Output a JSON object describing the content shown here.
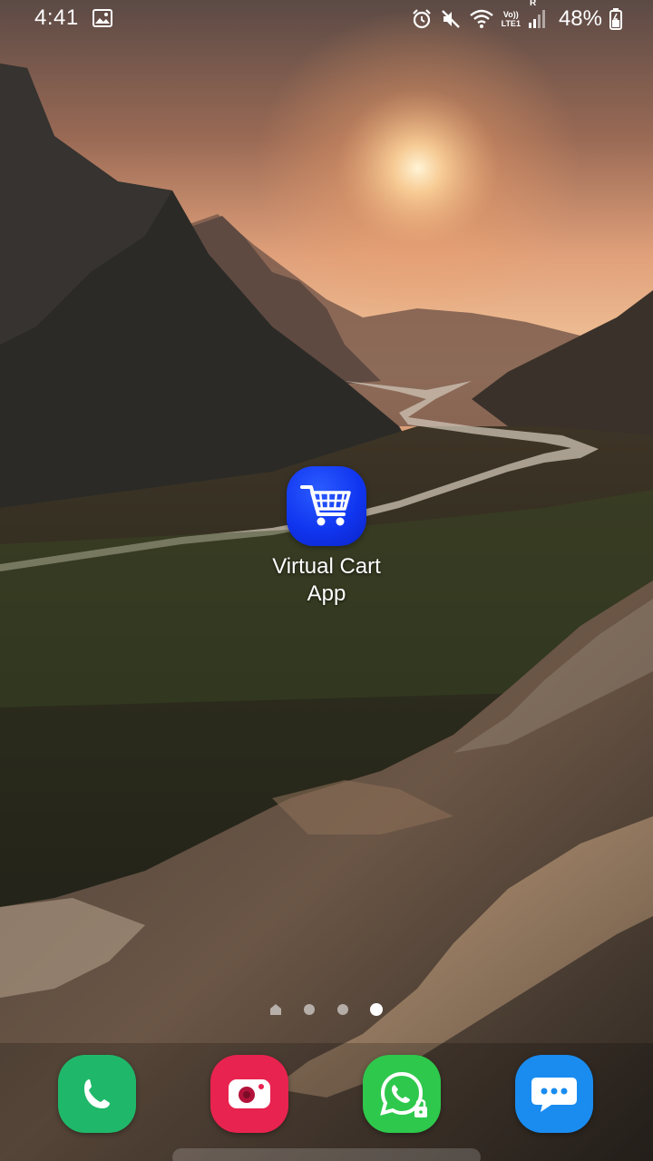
{
  "status_bar": {
    "time": "4:41",
    "battery": "48%",
    "network_top": "Vo))",
    "network_bottom": "LTE1",
    "roaming": "R",
    "icons": [
      "gallery-icon",
      "alarm-icon",
      "mute-icon",
      "wifi-icon",
      "volte-icon",
      "signal-icon",
      "battery-charging-icon"
    ]
  },
  "home_screen": {
    "app": {
      "label": "Virtual Cart App",
      "icon": "shopping-cart-icon",
      "color": "#1136f0"
    },
    "page_indicator": {
      "pages": 4,
      "current": 4
    }
  },
  "dock": [
    {
      "name": "phone",
      "icon": "phone-icon",
      "color": "#1fb86a"
    },
    {
      "name": "camera",
      "icon": "camera-icon",
      "color": "#e8234f"
    },
    {
      "name": "whatsapp",
      "icon": "whatsapp-icon",
      "color": "#2ec84c",
      "locked": true
    },
    {
      "name": "messages",
      "icon": "messages-icon",
      "color": "#1a8cf0"
    }
  ]
}
